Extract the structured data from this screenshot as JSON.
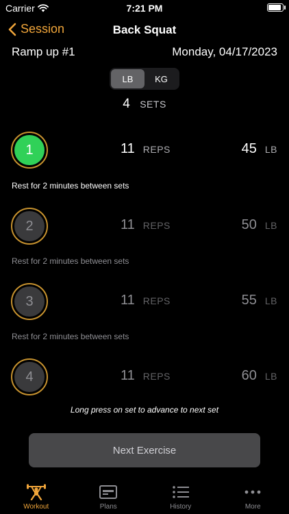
{
  "status_bar": {
    "carrier": "Carrier",
    "time": "7:21 PM"
  },
  "nav": {
    "back_label": "Session",
    "title": "Back Squat"
  },
  "info": {
    "label": "Ramp up #1",
    "date": "Monday, 04/17/2023"
  },
  "units": {
    "options": [
      "LB",
      "KG"
    ],
    "selected": "LB"
  },
  "sets_summary": {
    "count": "4",
    "label": "SETS"
  },
  "sets": [
    {
      "number": "1",
      "reps": "11",
      "reps_unit": "REPS",
      "weight": "45",
      "weight_unit": "LB",
      "rest": "Rest for 2 minutes between sets",
      "state": "active"
    },
    {
      "number": "2",
      "reps": "11",
      "reps_unit": "REPS",
      "weight": "50",
      "weight_unit": "LB",
      "rest": "Rest for 2 minutes between sets",
      "state": "pending"
    },
    {
      "number": "3",
      "reps": "11",
      "reps_unit": "REPS",
      "weight": "55",
      "weight_unit": "LB",
      "rest": "Rest for 2 minutes between sets",
      "state": "pending"
    },
    {
      "number": "4",
      "reps": "11",
      "reps_unit": "REPS",
      "weight": "60",
      "weight_unit": "LB",
      "state": "pending"
    }
  ],
  "hint": "Long press on set to advance to next set",
  "next_button": "Next Exercise",
  "tabs": [
    {
      "label": "Workout",
      "icon": "weightlifter-icon",
      "active": true
    },
    {
      "label": "Plans",
      "icon": "plans-card-icon",
      "active": false
    },
    {
      "label": "History",
      "icon": "list-icon",
      "active": false
    },
    {
      "label": "More",
      "icon": "more-dots-icon",
      "active": false
    }
  ],
  "colors": {
    "accent": "#f0a53a",
    "ring": "#c8932f",
    "active_set": "#30d158",
    "button_bg": "#48484a"
  }
}
